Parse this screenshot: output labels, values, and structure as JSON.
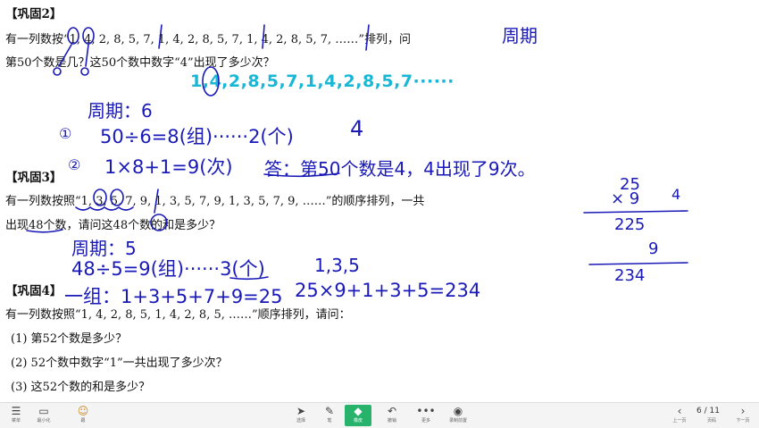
{
  "problem2": {
    "heading": "【巩固2】",
    "line1_a": "有一列数按“",
    "line1_seq": "1, 4, 2, 8, 5, 7, 1, 4, 2, 8, 5, 7, 1, 4, 2, 8, 5, 7, ……",
    "line1_b": "”排列，问",
    "line2": "第50个数是几？这50个数中数字“4”出现了多少次？",
    "cyan_seq": "1,4,2,8,5,7,1,4,2,8,5,7······"
  },
  "handwriting2": {
    "title": "周期",
    "period": "周期：6",
    "step1_num": "①",
    "step1": "50÷6=8(组)······2(个)",
    "four": "4",
    "step2_num": "②",
    "step2": "1×8+1=9(次)",
    "answer": "答：第50个数是4，4出现了9次。"
  },
  "problem3": {
    "heading": "【巩固3】",
    "line1_a": "有一列数按照“",
    "line1_seq": "1, 3, 5, 7, 9, 1, 3, 5, 7, 9, 1, 3, 5, 7, 9, ……",
    "line1_b": "”的顺序排列，一共",
    "line2": "出现48个数，请问这48个数的和是多少？"
  },
  "handwriting3": {
    "period": "周期：5",
    "step1": "48÷5=9(组)······3(个)",
    "rem": "1,3,5",
    "group": "一组：1+3+5+7+9=25",
    "total": "25×9+1+3+5=234"
  },
  "calc": {
    "r1": "25",
    "r2": "× 9",
    "aside": "4",
    "r3": "225",
    "r4": "9",
    "r5": "234"
  },
  "problem4": {
    "heading": "【巩固4】",
    "line1": "有一列数按照“1, 4, 2, 8, 5, 1, 4, 2, 8, 5, ……”顺序排列，请问：",
    "q1": "(1)  第52个数是多少？",
    "q2": "(2)  52个数中数字“1”一共出现了多少次？",
    "q3": "(3)  这52个数的和是多少？"
  },
  "toolbar": {
    "left": [
      {
        "icon": "☰",
        "label": "菜单"
      },
      {
        "icon": "▭",
        "label": "最小化"
      },
      {
        "icon": "☺",
        "label": "跟"
      }
    ],
    "center": [
      {
        "icon": "➤",
        "label": "选择"
      },
      {
        "icon": "✎",
        "label": "笔"
      },
      {
        "icon": "◆",
        "label": "橡皮"
      },
      {
        "icon": "↶",
        "label": "撤销"
      },
      {
        "icon": "•••",
        "label": "更多"
      },
      {
        "icon": "◉",
        "label": "录制前置"
      }
    ],
    "page": "6 / 11",
    "prev_label": "上一页",
    "pages_label": "页码",
    "next_label": "下一页"
  },
  "colors": {
    "ink": "#1a1ab8",
    "cyan": "#19b7d6",
    "active": "#27b36c"
  }
}
